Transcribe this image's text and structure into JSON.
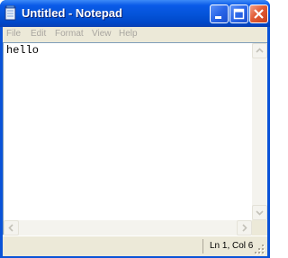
{
  "window": {
    "title": "Untitled - Notepad",
    "app_icon": "notepad-icon",
    "controls": {
      "minimize_icon": "minimize-icon",
      "maximize_icon": "maximize-icon",
      "close_icon": "close-icon"
    }
  },
  "menubar": {
    "items": [
      {
        "label": "File"
      },
      {
        "label": "Edit"
      },
      {
        "label": "Format"
      },
      {
        "label": "View"
      },
      {
        "label": "Help"
      }
    ]
  },
  "editor": {
    "content": "hello"
  },
  "statusbar": {
    "position": "Ln 1, Col 6"
  },
  "colors": {
    "titlebar": "#0453d8",
    "close_button": "#e25b34",
    "chrome": "#ece9d8",
    "menu_text_disabled": "#a9a6a0",
    "editor_background": "#ffffff"
  }
}
